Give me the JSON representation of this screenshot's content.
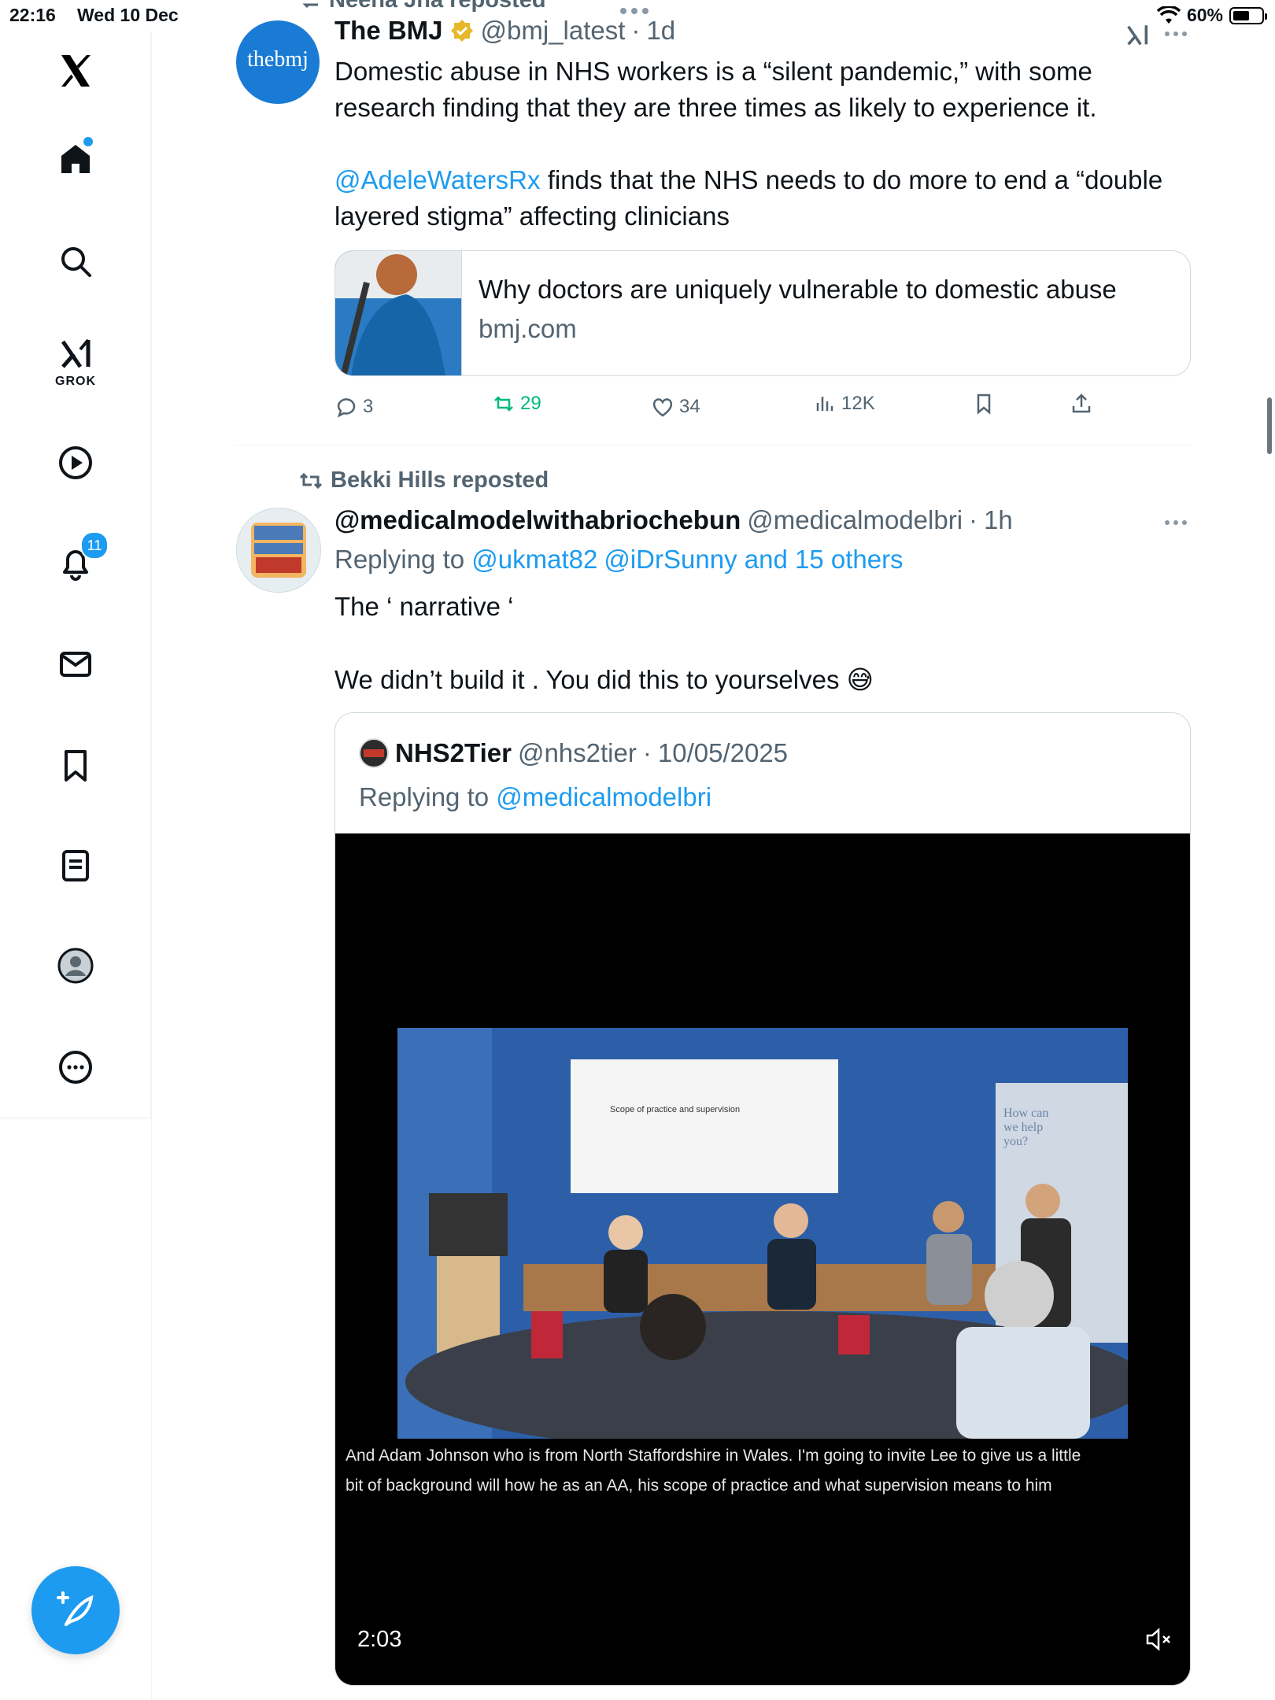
{
  "status": {
    "time": "22:16",
    "date": "Wed 10 Dec",
    "battery": "60%",
    "battery_level": 0.6
  },
  "sidebar": {
    "grok_label": "GROK",
    "notifications_count": "11",
    "items": [
      "home-icon",
      "search-icon",
      "grok-icon",
      "video-icon",
      "notifications-icon",
      "messages-icon",
      "bookmarks-icon",
      "lists-icon",
      "profile-icon",
      "more-icon"
    ]
  },
  "post1": {
    "repost_header": "Neena Jha reposted",
    "author": "The BMJ",
    "handle": "@bmj_latest",
    "time": "1d",
    "avatar_text": "thebmj",
    "text_line1": "Domestic abuse in NHS workers is a “silent pandemic,” with some research finding that they are three times as likely to experience it.",
    "mention": "@AdeleWatersRx",
    "text_line2": " finds that the NHS needs to do more to end a “double layered stigma” affecting clinicians",
    "card": {
      "title": "Why doctors are uniquely vulnerable to domestic abuse",
      "domain": "bmj.com"
    },
    "actions": {
      "replies": "3",
      "reposts": "29",
      "likes": "34",
      "views": "12K"
    }
  },
  "post2": {
    "repost_header": "Bekki Hills reposted",
    "author": "@medicalmodelwithabriochebun",
    "handle": "@medicalmodelbri",
    "time": "1h",
    "replying_prefix": "Replying to ",
    "replying_to_1": "@ukmat82",
    "replying_to_2": "@iDrSunny and 15 others",
    "text_line1": "The ‘ narrative ‘",
    "text_line2": "We didn’t build it . You did this to yourselves 😅",
    "quote": {
      "author": "NHS2Tier",
      "handle": "@nhs2tier",
      "date": "10/05/2025",
      "replying_prefix": "Replying to ",
      "replying_to": "@medicalmodelbri",
      "video_caption_1": "And Adam Johnson who is from North Staffordshire in Wales.  I'm going to invite Lee to give us a little",
      "video_caption_2": "bit of background will how he as an AA, his scope of practice and what supervision means to him",
      "video_duration": "2:03",
      "slide_text": "Scope of practice and supervision",
      "banner_text": "How can we help you?"
    }
  },
  "separator": "·",
  "colors": {
    "accent": "#1d9bf0",
    "repost_green": "#00ba7c",
    "muted": "#536471",
    "verified": "#e8b82b"
  }
}
